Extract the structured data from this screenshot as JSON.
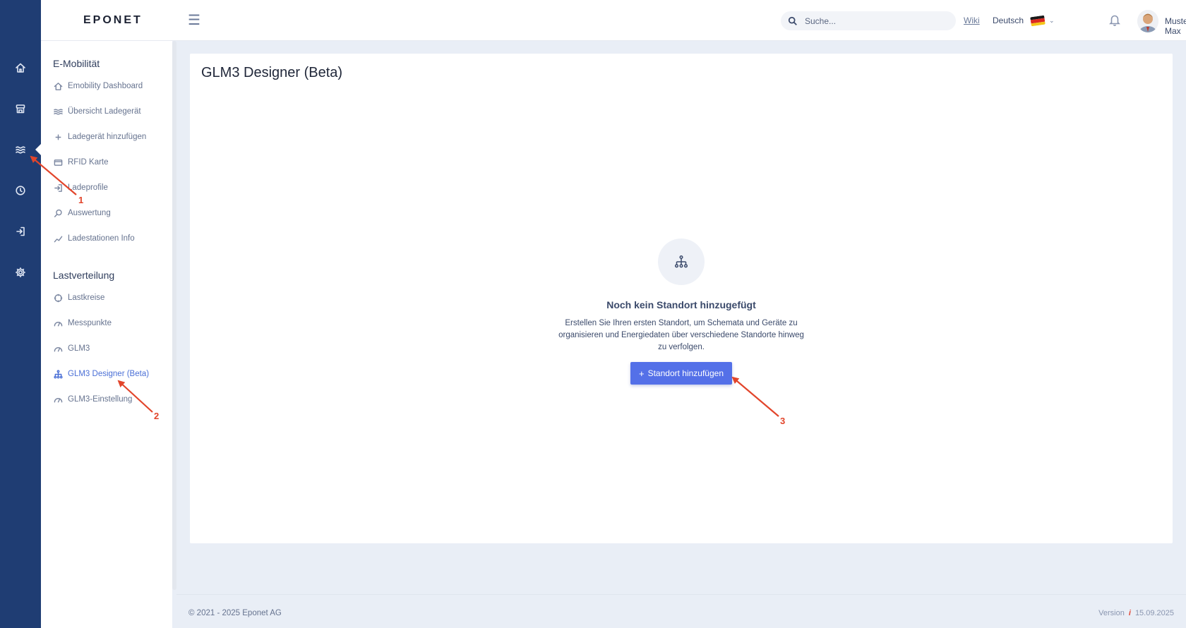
{
  "header": {
    "logo": "EPONET",
    "search_placeholder": "Suche...",
    "wiki": "Wiki",
    "language": "Deutsch",
    "user_name": "Muster Max"
  },
  "rail": {
    "icons": [
      "home-icon",
      "store-icon",
      "waves-icon",
      "clock-icon",
      "login-icon",
      "gear-icon"
    ],
    "active_index": 2
  },
  "sidebar": {
    "section1": "E-Mobilität",
    "items1": [
      {
        "label": "Emobility Dashboard"
      },
      {
        "label": "Übersicht Ladegerät"
      },
      {
        "label": "Ladegerät hinzufügen"
      },
      {
        "label": "RFID Karte"
      },
      {
        "label": "Ladeprofile"
      },
      {
        "label": "Auswertung"
      },
      {
        "label": "Ladestationen Info"
      }
    ],
    "section2": "Lastverteilung",
    "items2": [
      {
        "label": "Lastkreise"
      },
      {
        "label": "Messpunkte"
      },
      {
        "label": "GLM3"
      },
      {
        "label": "GLM3 Designer (Beta)"
      },
      {
        "label": "GLM3-Einstellung"
      }
    ],
    "active_item": "GLM3 Designer (Beta)"
  },
  "main": {
    "title": "GLM3 Designer (Beta)",
    "empty_title": "Noch kein Standort hinzugefügt",
    "empty_text": "Erstellen Sie Ihren ersten Standort, um Schemata und Geräte zu organisieren und Energiedaten über verschiedene Standorte hinweg zu verfolgen.",
    "add_button": "Standort hinzufügen"
  },
  "footer": {
    "copyright": "© 2021 - 2025 Eponet AG",
    "version_label": "Version",
    "version_info": "i",
    "version_date": "15.09.2025"
  },
  "annotations": {
    "n1": "1",
    "n2": "2",
    "n3": "3"
  },
  "colors": {
    "rail": "#1f3d73",
    "accent": "#5470e8",
    "annotation": "#e2452b"
  }
}
